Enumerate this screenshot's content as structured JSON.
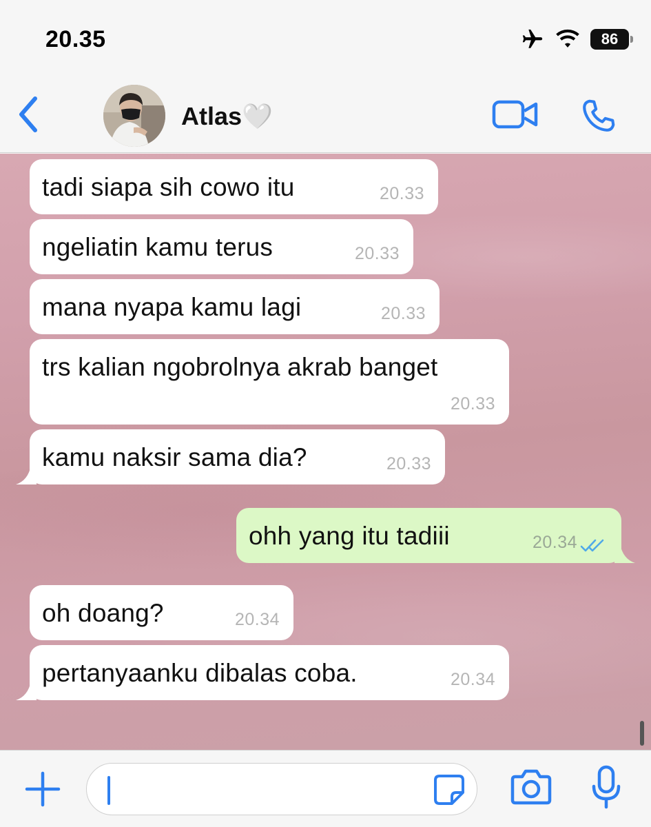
{
  "status_bar": {
    "time": "20.35",
    "battery": "86"
  },
  "header": {
    "contact_name": "Atlas",
    "contact_emoji": "🤍"
  },
  "messages": [
    {
      "direction": "in",
      "text": "tadi siapa sih cowo itu",
      "time": "20.33"
    },
    {
      "direction": "in",
      "text": "ngeliatin kamu terus",
      "time": "20.33"
    },
    {
      "direction": "in",
      "text": "mana nyapa kamu lagi",
      "time": "20.33"
    },
    {
      "direction": "in",
      "text": "trs kalian ngobrolnya akrab banget",
      "time": "20.33"
    },
    {
      "direction": "in",
      "text": "kamu naksir sama dia?",
      "time": "20.33"
    },
    {
      "direction": "out",
      "text": "ohh yang itu tadiii",
      "time": "20.34",
      "status": "read"
    },
    {
      "direction": "in",
      "text": "oh doang?",
      "time": "20.34"
    },
    {
      "direction": "in",
      "text": "pertanyaanku dibalas coba.",
      "time": "20.34"
    }
  ],
  "input": {
    "value": ""
  },
  "colors": {
    "accent": "#2e7ff0",
    "outgoing_bubble": "#dcf8c6",
    "incoming_bubble": "#ffffff",
    "chat_background": "#d2a0ac",
    "read_check": "#4fa9e8"
  },
  "icons": [
    "back-chevron-icon",
    "airplane-icon",
    "wifi-icon",
    "battery-icon",
    "video-camera-icon",
    "phone-icon",
    "plus-icon",
    "sticker-icon",
    "camera-icon",
    "microphone-icon",
    "double-check-icon"
  ]
}
